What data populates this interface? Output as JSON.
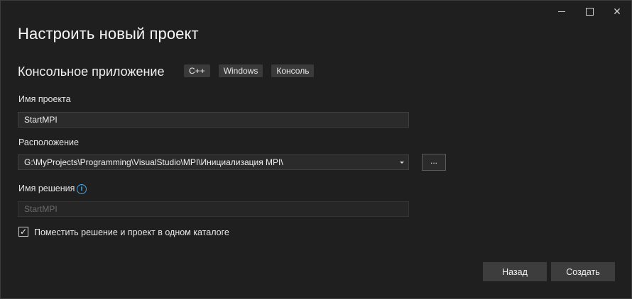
{
  "window": {
    "controls": {
      "minimize": "minimize-icon",
      "maximize": "maximize-icon",
      "close": "close-icon",
      "close_glyph": "✕"
    }
  },
  "title": "Настроить новый проект",
  "template": {
    "name": "Консольное приложение",
    "tags": [
      "C++",
      "Windows",
      "Консоль"
    ]
  },
  "project_name": {
    "label": "Имя проекта",
    "value": "StartMPI"
  },
  "location": {
    "label": "Расположение",
    "value": "G:\\MyProjects\\Programming\\VisualStudio\\MPI\\Инициализация MPI\\",
    "browse_label": "..."
  },
  "solution_name": {
    "label": "Имя решения",
    "info_glyph": "i",
    "value": "StartMPI",
    "disabled": true
  },
  "same_directory": {
    "checked": true,
    "check_glyph": "✓",
    "label": "Поместить решение и проект в одном каталоге"
  },
  "buttons": {
    "back": "Назад",
    "create": "Создать"
  },
  "colors": {
    "background": "#1f1f1f",
    "field": "#2b2b2b",
    "button": "#3d3d3d",
    "info_accent": "#4aa3e0"
  }
}
